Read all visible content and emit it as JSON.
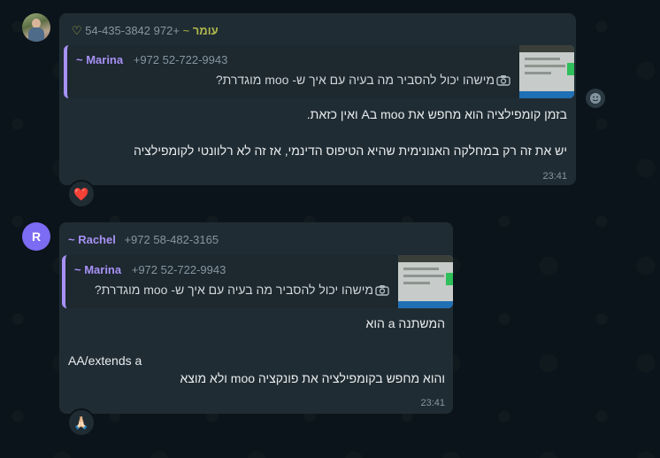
{
  "messages": [
    {
      "sender_name": "עומר",
      "sender_prefix": "~",
      "sender_phone": "+972 54-435-3842",
      "sender_color": "#b0b94d",
      "quote": {
        "name": "~ Marina",
        "phone": "+972 52-722-9943",
        "text": "מישהו יכול להסביר מה בעיה עם איך ש- moo מוגדרת?"
      },
      "lines": [
        "בזמן קומפילציה הוא מחפש את moo בA ואין כזאת.",
        "יש את זה רק במחלקה האנונימית שהיא הטיפוס הדינמי, אז זה לא רלוונטי לקומפילציה"
      ],
      "time": "23:41",
      "reaction": "❤️"
    },
    {
      "avatar_letter": "R",
      "sender_name": "~ Rachel",
      "sender_phone": "+972 58-482-3165",
      "sender_color": "#a791f5",
      "quote": {
        "name": "~ Marina",
        "phone": "+972 52-722-9943",
        "text": "מישהו יכול להסביר מה בעיה עם איך ש- moo מוגדרת?"
      },
      "lines": [
        "המשתנה a הוא",
        "AA/extends a",
        "והוא מחפש בקומפילציה את פונקציה moo ולא מוצא"
      ],
      "time": "23:41",
      "reaction": "🙏🏻"
    }
  ]
}
